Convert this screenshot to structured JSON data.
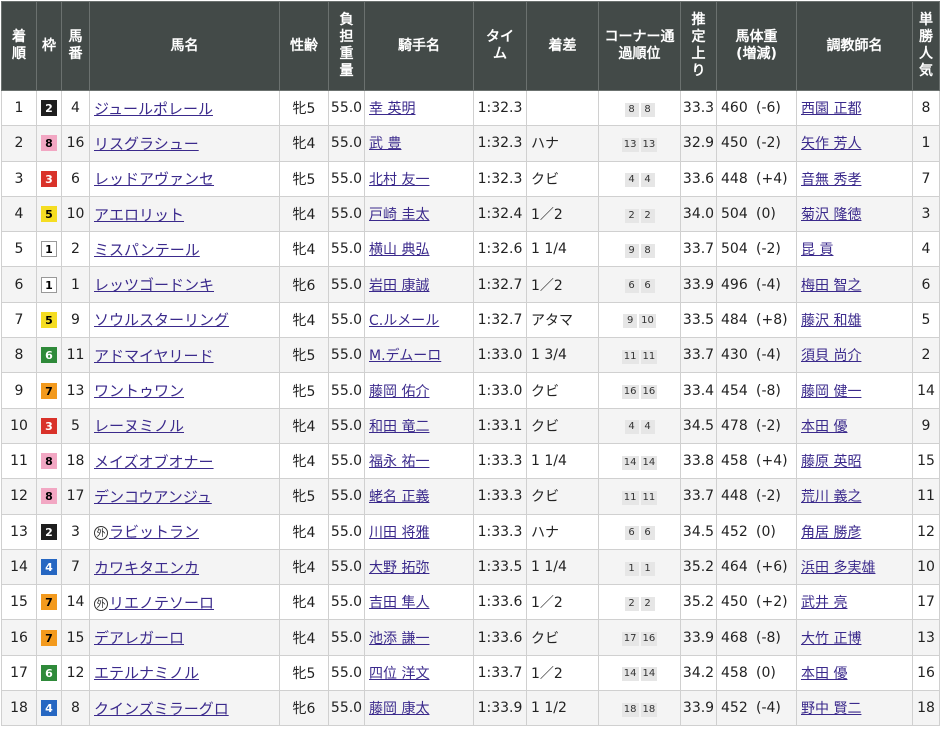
{
  "headers": {
    "rank": "着順",
    "waku": "枠",
    "umaban": "馬番",
    "horse": "馬名",
    "sexage": "性齢",
    "weight": "負担重量",
    "jockey": "騎手名",
    "time": "タイム",
    "margin": "着差",
    "corner": "コーナー通過順位",
    "last3f": "推定上り",
    "body": "馬体重(増減)",
    "trainer": "調教師名",
    "pop": "単勝人気"
  },
  "waku_colors": {
    "1": {
      "bg": "#ffffff",
      "fg": "#000000",
      "border": "#999999"
    },
    "2": {
      "bg": "#1e1e1e",
      "fg": "#ffffff",
      "border": "#1e1e1e"
    },
    "3": {
      "bg": "#d9322a",
      "fg": "#ffffff",
      "border": "#d9322a"
    },
    "4": {
      "bg": "#2667c2",
      "fg": "#ffffff",
      "border": "#2667c2"
    },
    "5": {
      "bg": "#f5dd22",
      "fg": "#000000",
      "border": "#f5dd22"
    },
    "6": {
      "bg": "#2f8a3a",
      "fg": "#ffffff",
      "border": "#2f8a3a"
    },
    "7": {
      "bg": "#f39a1d",
      "fg": "#000000",
      "border": "#f39a1d"
    },
    "8": {
      "bg": "#f2a7c3",
      "fg": "#000000",
      "border": "#f2a7c3"
    }
  },
  "link_color": "#3b2a8c",
  "rows": [
    {
      "rank": "1",
      "waku": "2",
      "umaban": "4",
      "mark": "",
      "horse": "ジュールポレール",
      "sexage": "牝5",
      "weight": "55.0",
      "jockey": "幸 英明",
      "time": "1:32.3",
      "margin": "",
      "corner": [
        "8",
        "8"
      ],
      "last3f": "33.3",
      "body": "460",
      "diff": "(-6)",
      "trainer": "西園 正都",
      "pop": "8"
    },
    {
      "rank": "2",
      "waku": "8",
      "umaban": "16",
      "mark": "",
      "horse": "リスグラシュー",
      "sexage": "牝4",
      "weight": "55.0",
      "jockey": "武 豊",
      "time": "1:32.3",
      "margin": "ハナ",
      "corner": [
        "13",
        "13"
      ],
      "last3f": "32.9",
      "body": "450",
      "diff": "(-2)",
      "trainer": "矢作 芳人",
      "pop": "1"
    },
    {
      "rank": "3",
      "waku": "3",
      "umaban": "6",
      "mark": "",
      "horse": "レッドアヴァンセ",
      "sexage": "牝5",
      "weight": "55.0",
      "jockey": "北村 友一",
      "time": "1:32.3",
      "margin": "クビ",
      "corner": [
        "4",
        "4"
      ],
      "last3f": "33.6",
      "body": "448",
      "diff": "(+4)",
      "trainer": "音無 秀孝",
      "pop": "7"
    },
    {
      "rank": "4",
      "waku": "5",
      "umaban": "10",
      "mark": "",
      "horse": "アエロリット",
      "sexage": "牝4",
      "weight": "55.0",
      "jockey": "戸崎 圭太",
      "time": "1:32.4",
      "margin": "1／2",
      "corner": [
        "2",
        "2"
      ],
      "last3f": "34.0",
      "body": "504",
      "diff": "(0)",
      "trainer": "菊沢 隆徳",
      "pop": "3"
    },
    {
      "rank": "5",
      "waku": "1",
      "umaban": "2",
      "mark": "",
      "horse": "ミスパンテール",
      "sexage": "牝4",
      "weight": "55.0",
      "jockey": "横山 典弘",
      "time": "1:32.6",
      "margin": "1 1/4",
      "corner": [
        "9",
        "8"
      ],
      "last3f": "33.7",
      "body": "504",
      "diff": "(-2)",
      "trainer": "昆 貢",
      "pop": "4"
    },
    {
      "rank": "6",
      "waku": "1",
      "umaban": "1",
      "mark": "",
      "horse": "レッツゴードンキ",
      "sexage": "牝6",
      "weight": "55.0",
      "jockey": "岩田 康誠",
      "time": "1:32.7",
      "margin": "1／2",
      "corner": [
        "6",
        "6"
      ],
      "last3f": "33.9",
      "body": "496",
      "diff": "(-4)",
      "trainer": "梅田 智之",
      "pop": "6"
    },
    {
      "rank": "7",
      "waku": "5",
      "umaban": "9",
      "mark": "",
      "horse": "ソウルスターリング",
      "sexage": "牝4",
      "weight": "55.0",
      "jockey": "C.ルメール",
      "time": "1:32.7",
      "margin": "アタマ",
      "corner": [
        "9",
        "10"
      ],
      "last3f": "33.5",
      "body": "484",
      "diff": "(+8)",
      "trainer": "藤沢 和雄",
      "pop": "5"
    },
    {
      "rank": "8",
      "waku": "6",
      "umaban": "11",
      "mark": "",
      "horse": "アドマイヤリード",
      "sexage": "牝5",
      "weight": "55.0",
      "jockey": "M.デムーロ",
      "time": "1:33.0",
      "margin": "1 3/4",
      "corner": [
        "11",
        "11"
      ],
      "last3f": "33.7",
      "body": "430",
      "diff": "(-4)",
      "trainer": "須貝 尚介",
      "pop": "2"
    },
    {
      "rank": "9",
      "waku": "7",
      "umaban": "13",
      "mark": "",
      "horse": "ワントゥワン",
      "sexage": "牝5",
      "weight": "55.0",
      "jockey": "藤岡 佑介",
      "time": "1:33.0",
      "margin": "クビ",
      "corner": [
        "16",
        "16"
      ],
      "last3f": "33.4",
      "body": "454",
      "diff": "(-8)",
      "trainer": "藤岡 健一",
      "pop": "14"
    },
    {
      "rank": "10",
      "waku": "3",
      "umaban": "5",
      "mark": "",
      "horse": "レーヌミノル",
      "sexage": "牝4",
      "weight": "55.0",
      "jockey": "和田 竜二",
      "time": "1:33.1",
      "margin": "クビ",
      "corner": [
        "4",
        "4"
      ],
      "last3f": "34.5",
      "body": "478",
      "diff": "(-2)",
      "trainer": "本田 優",
      "pop": "9"
    },
    {
      "rank": "11",
      "waku": "8",
      "umaban": "18",
      "mark": "",
      "horse": "メイズオブオナー",
      "sexage": "牝4",
      "weight": "55.0",
      "jockey": "福永 祐一",
      "time": "1:33.3",
      "margin": "1 1/4",
      "corner": [
        "14",
        "14"
      ],
      "last3f": "33.8",
      "body": "458",
      "diff": "(+4)",
      "trainer": "藤原 英昭",
      "pop": "15"
    },
    {
      "rank": "12",
      "waku": "8",
      "umaban": "17",
      "mark": "",
      "horse": "デンコウアンジュ",
      "sexage": "牝5",
      "weight": "55.0",
      "jockey": "蛯名 正義",
      "time": "1:33.3",
      "margin": "クビ",
      "corner": [
        "11",
        "11"
      ],
      "last3f": "33.7",
      "body": "448",
      "diff": "(-2)",
      "trainer": "荒川 義之",
      "pop": "11"
    },
    {
      "rank": "13",
      "waku": "2",
      "umaban": "3",
      "mark": "外",
      "horse": "ラビットラン",
      "sexage": "牝4",
      "weight": "55.0",
      "jockey": "川田 将雅",
      "time": "1:33.3",
      "margin": "ハナ",
      "corner": [
        "6",
        "6"
      ],
      "last3f": "34.5",
      "body": "452",
      "diff": "(0)",
      "trainer": "角居 勝彦",
      "pop": "12"
    },
    {
      "rank": "14",
      "waku": "4",
      "umaban": "7",
      "mark": "",
      "horse": "カワキタエンカ",
      "sexage": "牝4",
      "weight": "55.0",
      "jockey": "大野 拓弥",
      "time": "1:33.5",
      "margin": "1 1/4",
      "corner": [
        "1",
        "1"
      ],
      "last3f": "35.2",
      "body": "464",
      "diff": "(+6)",
      "trainer": "浜田 多実雄",
      "pop": "10"
    },
    {
      "rank": "15",
      "waku": "7",
      "umaban": "14",
      "mark": "外",
      "horse": "リエノテソーロ",
      "sexage": "牝4",
      "weight": "55.0",
      "jockey": "吉田 隼人",
      "time": "1:33.6",
      "margin": "1／2",
      "corner": [
        "2",
        "2"
      ],
      "last3f": "35.2",
      "body": "450",
      "diff": "(+2)",
      "trainer": "武井 亮",
      "pop": "17"
    },
    {
      "rank": "16",
      "waku": "7",
      "umaban": "15",
      "mark": "",
      "horse": "デアレガーロ",
      "sexage": "牝4",
      "weight": "55.0",
      "jockey": "池添 謙一",
      "time": "1:33.6",
      "margin": "クビ",
      "corner": [
        "17",
        "16"
      ],
      "last3f": "33.9",
      "body": "468",
      "diff": "(-8)",
      "trainer": "大竹 正博",
      "pop": "13"
    },
    {
      "rank": "17",
      "waku": "6",
      "umaban": "12",
      "mark": "",
      "horse": "エテルナミノル",
      "sexage": "牝5",
      "weight": "55.0",
      "jockey": "四位 洋文",
      "time": "1:33.7",
      "margin": "1／2",
      "corner": [
        "14",
        "14"
      ],
      "last3f": "34.2",
      "body": "458",
      "diff": "(0)",
      "trainer": "本田 優",
      "pop": "16"
    },
    {
      "rank": "18",
      "waku": "4",
      "umaban": "8",
      "mark": "",
      "horse": "クインズミラーグロ",
      "sexage": "牝6",
      "weight": "55.0",
      "jockey": "藤岡 康太",
      "time": "1:33.9",
      "margin": "1 1/2",
      "corner": [
        "18",
        "18"
      ],
      "last3f": "33.9",
      "body": "452",
      "diff": "(-4)",
      "trainer": "野中 賢二",
      "pop": "18"
    }
  ]
}
